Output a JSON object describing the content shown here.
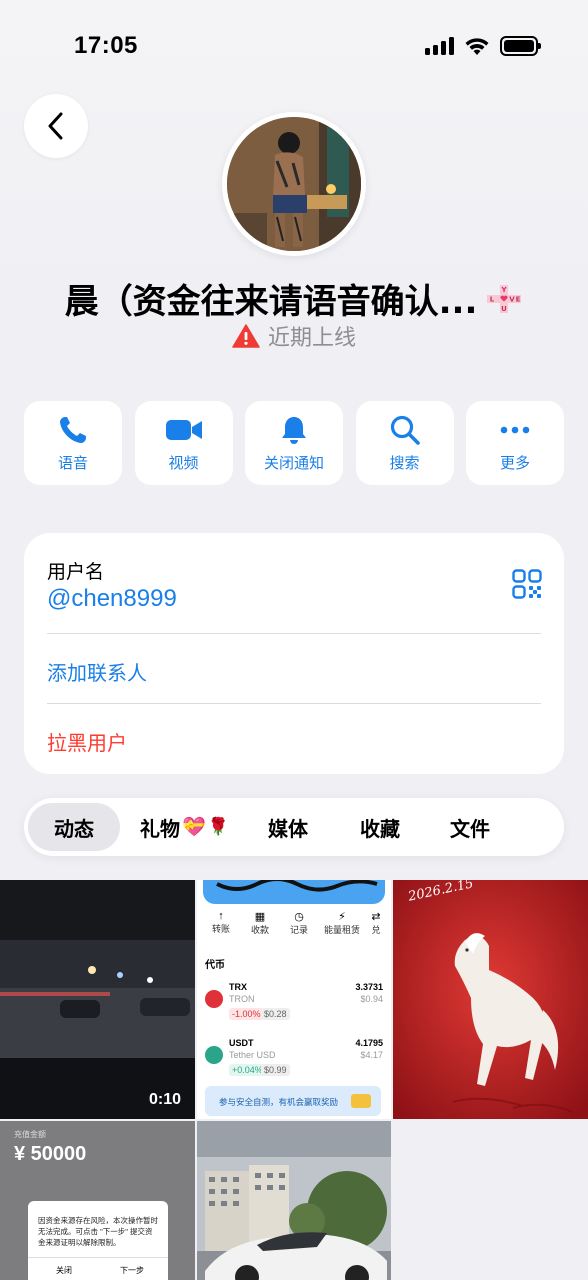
{
  "status_bar": {
    "time": "17:05"
  },
  "profile": {
    "name": "晨（资金往来请语音确认...",
    "badge_text": [
      "L",
      "O",
      "V",
      "E",
      "Y",
      "U"
    ],
    "status": "近期上线"
  },
  "actions": [
    {
      "label": "语音",
      "icon": "phone-icon"
    },
    {
      "label": "视频",
      "icon": "video-icon"
    },
    {
      "label": "关闭通知",
      "icon": "bell-icon"
    },
    {
      "label": "搜索",
      "icon": "search-icon"
    },
    {
      "label": "更多",
      "icon": "more-icon"
    }
  ],
  "info": {
    "username_label": "用户名",
    "username": "@chen8999",
    "add_contact": "添加联系人",
    "block_user": "拉黑用户"
  },
  "tabs": [
    {
      "label": "动态",
      "active": true
    },
    {
      "label": "礼物",
      "active": false
    },
    {
      "label": "媒体",
      "active": false
    },
    {
      "label": "收藏",
      "active": false
    },
    {
      "label": "文件",
      "active": false
    }
  ],
  "tab_emojis": [
    "💝",
    "🌹"
  ],
  "media": {
    "video_duration": "0:10",
    "wallet": {
      "nav_items": [
        "转账",
        "收款",
        "记录",
        "能量租赁",
        "兑"
      ],
      "section": "代币",
      "tokens": [
        {
          "symbol": "TRX",
          "network": "TRON",
          "amount": "3.3731",
          "usd": "$0.94",
          "change": "-1.00%",
          "price": "$0.28"
        },
        {
          "symbol": "USDT",
          "network": "Tether USD",
          "amount": "4.1795",
          "usd": "$4.17",
          "change": "+0.04%",
          "price": "$0.99"
        }
      ],
      "banner": "参与安全自测，有机会赢取奖励"
    },
    "horse_date": "2026.2.15",
    "transfer": {
      "label": "充值金额",
      "amount": "¥ 50000",
      "dialog_text": "因资金来源存在风险，本次操作暂时无法完成。可点击 \"下一步\" 提交资金来源证明以解除限制。",
      "btn_close": "关闭",
      "btn_next": "下一步"
    }
  },
  "colors": {
    "accent": "#1a7fe8",
    "danger": "#ff3b30",
    "background": "#efeff4"
  }
}
